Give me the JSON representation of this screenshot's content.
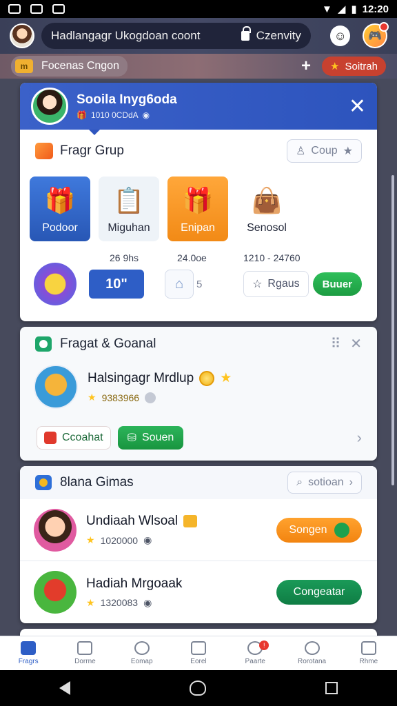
{
  "status_bar": {
    "time": "12:20"
  },
  "header": {
    "search_text": "Hadlangagr Ukogdoan coont",
    "lock_label": "Czenvity",
    "smile_icon": "smile-icon"
  },
  "subbar": {
    "tile_label": "m",
    "pill_label": "Focenas Cngon",
    "plus": "+",
    "red_pill_label": "Soitrah"
  },
  "profile": {
    "name": "Sooila Inyg6oda",
    "sub": "1010 0CDdA"
  },
  "group": {
    "title": "Fragr Grup",
    "group_button": "Coup",
    "tiles": [
      {
        "label": "Podoor",
        "glyph": "🎁"
      },
      {
        "label": "Miguhan",
        "glyph": "📋"
      },
      {
        "label": "Enipan",
        "glyph": "🎁"
      },
      {
        "label": "Senosol",
        "glyph": "👜"
      }
    ],
    "stats": [
      "26 9hs",
      "24.0oe",
      "1210 - 24760"
    ],
    "count_button": "10\"",
    "bag_count": "5",
    "rgaus_button": "Rgaus",
    "green_button": "Buuer"
  },
  "friends": {
    "title": "Fragat & Goanal",
    "name": "Halsingagr Mrdlup",
    "points": "9383966",
    "red_button": "Ccoahat",
    "green_button": "Souen"
  },
  "gifts": {
    "title": "8lana Gimas",
    "button": "sotioan",
    "rows": [
      {
        "name": "Undiaah Wlsoal",
        "points": "1020000",
        "button": "Songen"
      },
      {
        "name": "Hadiah Mrgoaak",
        "points": "1320083",
        "button": "Congeatar"
      }
    ]
  },
  "bottom_nav": [
    {
      "label": "Fragrs"
    },
    {
      "label": "Dorrne"
    },
    {
      "label": "Eomap"
    },
    {
      "label": "Eorel"
    },
    {
      "label": "Paarte"
    },
    {
      "label": "Rorotana"
    },
    {
      "label": "Rhme"
    }
  ],
  "colors": {
    "primary": "#2e5ec6",
    "accent_orange": "#f28a16",
    "accent_green": "#1c9c42",
    "header_bg": "#3a3f58"
  }
}
